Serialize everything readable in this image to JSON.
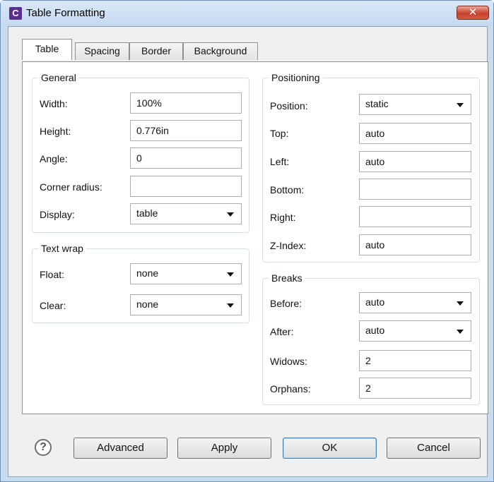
{
  "window": {
    "app_icon": "C",
    "title": "Table Formatting",
    "close_glyph": "✕"
  },
  "tabs": [
    {
      "label": "Table",
      "active": true
    },
    {
      "label": "Spacing",
      "active": false
    },
    {
      "label": "Border",
      "active": false
    },
    {
      "label": "Background",
      "active": false
    }
  ],
  "general": {
    "title": "General",
    "width_label": "Width:",
    "width_value": "100%",
    "height_label": "Height:",
    "height_value": "0.776in",
    "angle_label": "Angle:",
    "angle_value": "0",
    "corner_label": "Corner radius:",
    "corner_value": "",
    "display_label": "Display:",
    "display_value": "table"
  },
  "textwrap": {
    "title": "Text wrap",
    "float_label": "Float:",
    "float_value": "none",
    "clear_label": "Clear:",
    "clear_value": "none"
  },
  "positioning": {
    "title": "Positioning",
    "position_label": "Position:",
    "position_value": "static",
    "top_label": "Top:",
    "top_value": "auto",
    "left_label": "Left:",
    "left_value": "auto",
    "bottom_label": "Bottom:",
    "bottom_value": "",
    "right_label": "Right:",
    "right_value": "",
    "zindex_label": "Z-Index:",
    "zindex_value": "auto"
  },
  "breaks": {
    "title": "Breaks",
    "before_label": "Before:",
    "before_value": "auto",
    "after_label": "After:",
    "after_value": "auto",
    "widows_label": "Widows:",
    "widows_value": "2",
    "orphans_label": "Orphans:",
    "orphans_value": "2"
  },
  "buttons": {
    "help_glyph": "?",
    "advanced": "Advanced",
    "apply": "Apply",
    "ok": "OK",
    "cancel": "Cancel"
  },
  "icons": {
    "app": "app-logo-icon",
    "close": "close-icon",
    "help": "help-icon",
    "dropdown": "chevron-down-icon"
  }
}
